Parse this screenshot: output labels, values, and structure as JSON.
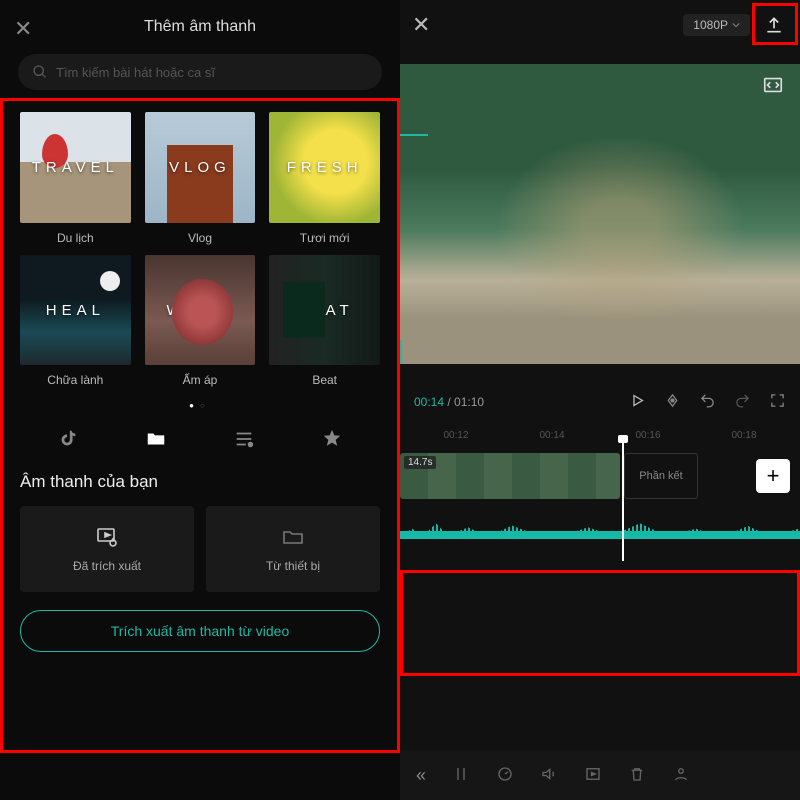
{
  "left": {
    "title": "Thêm âm thanh",
    "search_placeholder": "Tìm kiếm bài hát hoặc ca sĩ",
    "categories": [
      {
        "overlay": "TRAVEL",
        "label": "Du lịch",
        "bg": "bg-travel"
      },
      {
        "overlay": "VLOG",
        "label": "Vlog",
        "bg": "bg-vlog"
      },
      {
        "overlay": "FRESH",
        "label": "Tươi mới",
        "bg": "bg-fresh"
      },
      {
        "overlay": "HEAL",
        "label": "Chữa lành",
        "bg": "bg-heal"
      },
      {
        "overlay": "WARM",
        "label": "Ấm áp",
        "bg": "bg-warm"
      },
      {
        "overlay": "BEAT",
        "label": "Beat",
        "bg": "bg-beat"
      }
    ],
    "tabs": {
      "active_index": 1
    },
    "your_audio_title": "Âm thanh của bạn",
    "sources": {
      "extracted": "Đã trích xuất",
      "device": "Từ thiết bị"
    },
    "extract_button": "Trích xuất âm thanh từ video"
  },
  "right": {
    "resolution": "1080P",
    "time": {
      "current": "00:14",
      "total": "01:10"
    },
    "ruler": [
      "00:12",
      "00:14",
      "00:16",
      "00:18"
    ],
    "clip_duration": "14.7s",
    "end_label": "Phần kết"
  }
}
